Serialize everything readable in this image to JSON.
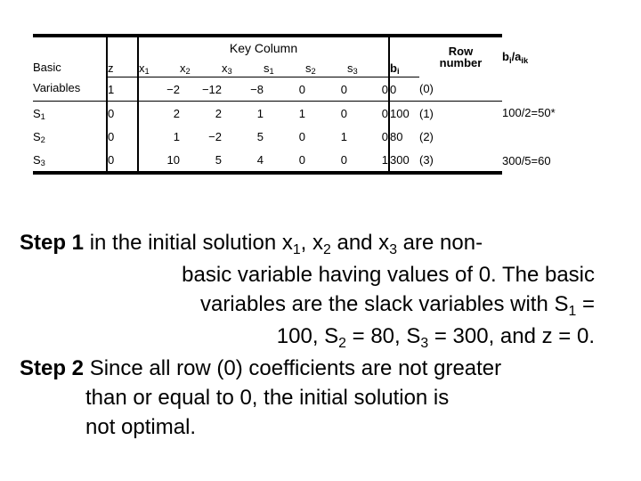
{
  "table": {
    "key_column_banner": "Key Column",
    "basic_header_line1": "Basic",
    "basic_header_line2": "Variables",
    "z_header": "z",
    "var_headers": [
      "x",
      "x",
      "x",
      "s",
      "s",
      "s"
    ],
    "var_subs": [
      "1",
      "2",
      "3",
      "1",
      "2",
      "3"
    ],
    "bi_header": "b",
    "bi_header_sub": "i",
    "rownum_header_line1": "Row",
    "rownum_header_line2": "number",
    "ratio_header": "b",
    "ratio_header_sub1": "i",
    "ratio_header_mid": "/a",
    "ratio_header_sub2": "ik",
    "rows": [
      {
        "label": "",
        "label_sub": "",
        "z": "1",
        "coefficients": [
          "−2",
          "−12",
          "−8",
          "0",
          "0",
          "0"
        ],
        "bi": "0",
        "rownum": "(0)",
        "ratio": ""
      },
      {
        "label": "S",
        "label_sub": "1",
        "z": "0",
        "coefficients": [
          "2",
          "2",
          "1",
          "1",
          "0",
          "0"
        ],
        "bi": "100",
        "rownum": "(1)",
        "ratio": "100/2=50*"
      },
      {
        "label": "S",
        "label_sub": "2",
        "z": "0",
        "coefficients": [
          "1",
          "−2",
          "5",
          "0",
          "1",
          "0"
        ],
        "bi": "80",
        "rownum": "(2)",
        "ratio": ""
      },
      {
        "label": "S",
        "label_sub": "3",
        "z": "0",
        "coefficients": [
          "10",
          "5",
          "4",
          "0",
          "0",
          "1"
        ],
        "bi": "300",
        "rownum": "(3)",
        "ratio": "300/5=60"
      }
    ]
  },
  "explanation": {
    "step1_label": "Step 1",
    "step1_l1_a": " in the initial solution x",
    "step1_l1_s1": "1",
    "step1_l1_b": ", x",
    "step1_l1_s2": "2",
    "step1_l1_c": " and x",
    "step1_l1_s3": "3",
    "step1_l1_d": " are non-",
    "step1_l2": "basic variable having values of 0. The basic",
    "step1_l3_a": "variables are the slack variables with S",
    "step1_l3_s": "1",
    "step1_l3_b": " =",
    "step1_l4_a": "100, S",
    "step1_l4_s1": "2",
    "step1_l4_b": " = 80, S",
    "step1_l4_s2": "3",
    "step1_l4_c": " = 300, and z = 0.",
    "step2_label": "Step 2",
    "step2_l1": " Since all row (0) coefficients are not greater",
    "step2_l2": "than or equal to 0, the initial solution is",
    "step2_l3": "not optimal."
  },
  "colors": {
    "text": "#000000",
    "background": "#ffffff",
    "rule": "#000000"
  }
}
